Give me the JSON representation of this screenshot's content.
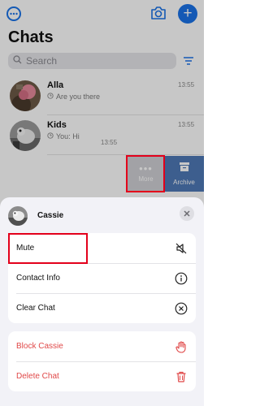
{
  "header": {
    "title": "Chats"
  },
  "search": {
    "placeholder": "Search"
  },
  "chats": [
    {
      "name": "Alla",
      "preview": "Are you there",
      "time": "13:55"
    },
    {
      "name": "Kids",
      "preview": "You: Hi",
      "time": "13:55"
    }
  ],
  "swiped_row": {
    "time": "13:55",
    "more_label": "More",
    "archive_label": "Archive"
  },
  "sheet": {
    "contact_name": "Cassie",
    "group1": [
      {
        "label": "Mute",
        "icon": "muted-speaker-icon"
      },
      {
        "label": "Contact Info",
        "icon": "info-icon"
      },
      {
        "label": "Clear Chat",
        "icon": "clear-x-icon"
      }
    ],
    "group2": [
      {
        "label": "Block Cassie",
        "icon": "hand-block-icon"
      },
      {
        "label": "Delete Chat",
        "icon": "trash-icon"
      }
    ]
  },
  "colors": {
    "accent": "#1a73e8",
    "archive": "#4f79b7",
    "danger": "#e04848",
    "highlight": "#e3001b"
  }
}
